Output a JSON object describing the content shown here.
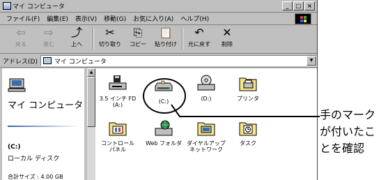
{
  "window": {
    "title": "マイ コンピュータ",
    "buttons": [
      "_",
      "□",
      "×"
    ]
  },
  "menu": [
    "ファイル(F)",
    "編集(E)",
    "表示(V)",
    "移動(G)",
    "お気に入り(A)",
    "ヘルプ(H)"
  ],
  "toolbar": {
    "back": {
      "icon": "⇦",
      "label": "戻る"
    },
    "forward": {
      "icon": "⇨",
      "label": "進む"
    },
    "up": {
      "icon": "⤴",
      "label": "上へ"
    },
    "cut": {
      "icon": "✂",
      "label": "切り取り"
    },
    "copy": {
      "icon": "⎘",
      "label": "コピー"
    },
    "paste": {
      "icon": "📋",
      "label": "貼り付け"
    },
    "undo": {
      "icon": "↶",
      "label": "元に戻す"
    },
    "delete": {
      "icon": "✕",
      "label": "削除"
    },
    "more": "»"
  },
  "address": {
    "label": "アドレス(D)",
    "value": "マイ コンピュータ"
  },
  "left_panel": {
    "title": "マイ コンピュータ",
    "drive": "(C:)",
    "disk_type": "ローカル ディスク",
    "total_size": "合計サイズ : 4.00 GB"
  },
  "items": [
    {
      "label": "3.5 インチ FD\n(A:)",
      "icon": "floppy-drive-icon"
    },
    {
      "label": "(C:)",
      "icon": "hard-drive-icon"
    },
    {
      "label": "(D:)",
      "icon": "cd-drive-icon"
    },
    {
      "label": "プリンタ",
      "icon": "printers-folder-icon"
    },
    {
      "label": "コントロール\nパネル",
      "icon": "control-panel-icon"
    },
    {
      "label": "Web フォルダ",
      "icon": "web-folders-icon"
    },
    {
      "label": "ダイヤルアップ\nネットワーク",
      "icon": "dialup-networking-icon"
    },
    {
      "label": "タスク",
      "icon": "scheduled-tasks-icon"
    }
  ],
  "annotation": {
    "text": "手のマーク\nが付いたこ\nとを確認"
  }
}
